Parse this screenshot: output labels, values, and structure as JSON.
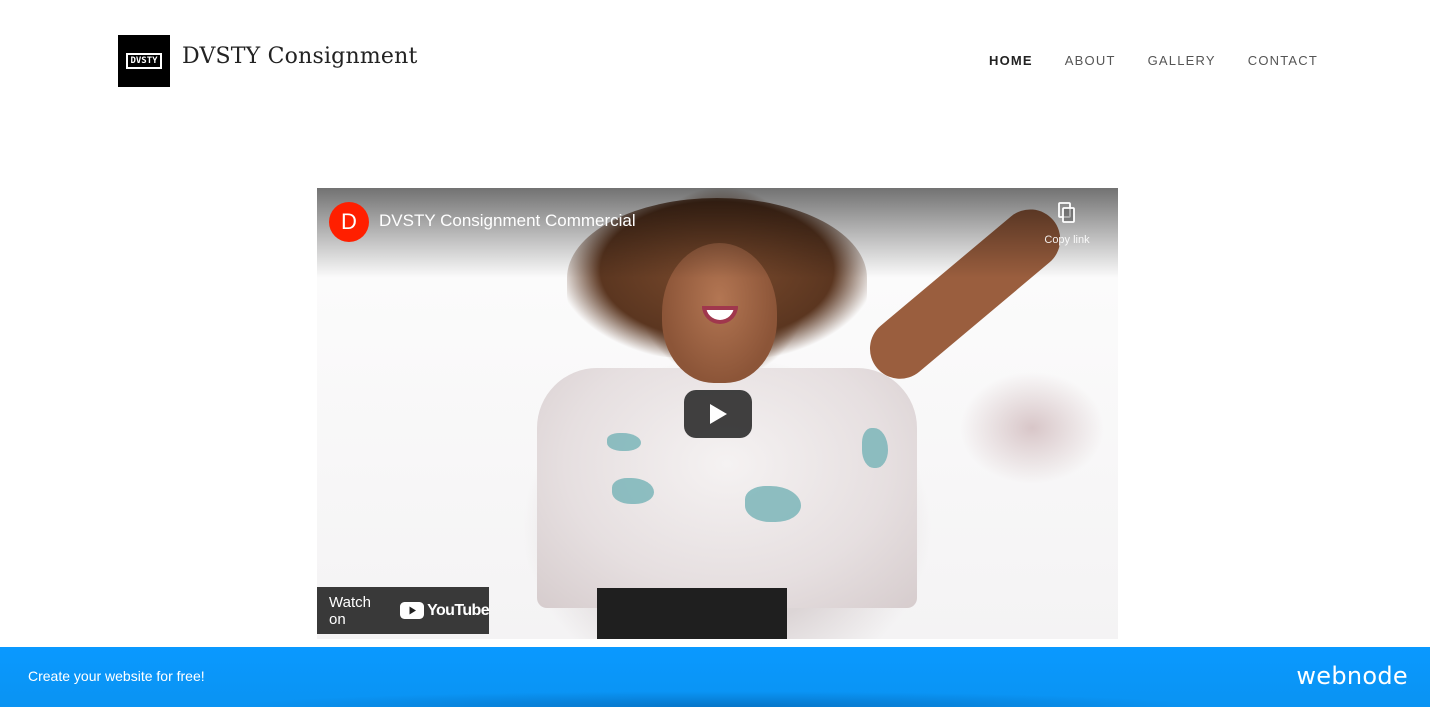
{
  "header": {
    "logo_text": "DVSTY",
    "site_title": "DVSTY Consignment",
    "nav": [
      {
        "label": "HOME",
        "active": true
      },
      {
        "label": "ABOUT",
        "active": false
      },
      {
        "label": "GALLERY",
        "active": false
      },
      {
        "label": "CONTACT",
        "active": false
      }
    ]
  },
  "video": {
    "channel_initial": "D",
    "title": "DVSTY Consignment Commercial",
    "copy_link_label": "Copy link",
    "watch_on_label": "Watch on",
    "youtube_label": "YouTube",
    "channel_color": "#ff1f00"
  },
  "banner": {
    "cta": "Create your website for free!",
    "brand": "webnode",
    "color": "#0a99ff"
  }
}
